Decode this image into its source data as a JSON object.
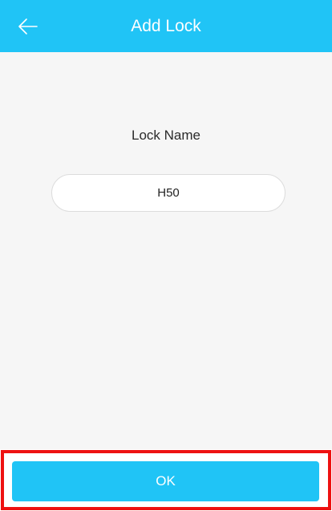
{
  "header": {
    "title": "Add Lock",
    "back_icon": "arrow-left-icon",
    "background_color": "#20c4f6"
  },
  "form": {
    "label": "Lock Name",
    "lock_name_value": "H50"
  },
  "footer": {
    "ok_label": "OK",
    "button_color": "#20c4f6",
    "highlight_color": "#ee1111"
  }
}
